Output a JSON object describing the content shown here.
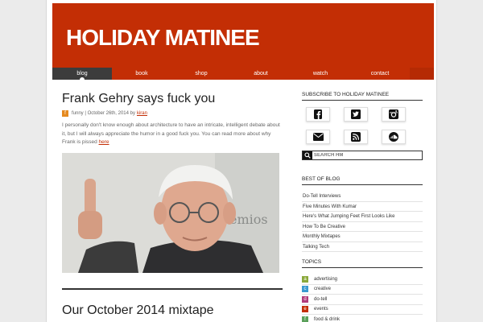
{
  "site": {
    "title": "HOLIDAY MATINEE"
  },
  "nav": [
    {
      "label": "blog"
    },
    {
      "label": "book"
    },
    {
      "label": "shop"
    },
    {
      "label": "about"
    },
    {
      "label": "watch"
    },
    {
      "label": "contact"
    }
  ],
  "post1": {
    "title": "Frank Gehry says fuck you",
    "category": "funny",
    "date": "October 26th, 2014 by",
    "author": "kiran",
    "excerpt": "I personally don't know enough about architecture to have an intricate, intelligent debate about it, but I will always appreciate the humor in a good fuck you. You can read more about why Frank is pissed ",
    "link_text": "here"
  },
  "post2": {
    "title": "Our October 2014 mixtape"
  },
  "sidebar": {
    "subscribe_title": "SUBSCRIBE TO HOLIDAY MATINEE",
    "social": [
      {
        "icon": "facebook-icon"
      },
      {
        "icon": "twitter-icon"
      },
      {
        "icon": "instagram-icon"
      },
      {
        "icon": "email-icon"
      },
      {
        "icon": "rss-icon"
      },
      {
        "icon": "soundcloud-icon"
      }
    ],
    "search_placeholder": "SEARCH HM",
    "best_title": "BEST OF BLOG",
    "best": [
      "Do-Tell Interviews",
      "Five Minutes With Kumar",
      "Here's What Jumping Feet First Looks Like",
      "How To Be Creative",
      "Monthly Mixtapes",
      "Talking Tech"
    ],
    "topics_title": "TOPICS",
    "topics": [
      {
        "label": "advertising",
        "color": "#8aa83a"
      },
      {
        "label": "creative",
        "color": "#3a9ad0"
      },
      {
        "label": "do-tell",
        "color": "#b03a7a"
      },
      {
        "label": "events",
        "color": "#c32e05"
      },
      {
        "label": "food & drink",
        "color": "#5aa05a"
      }
    ]
  }
}
